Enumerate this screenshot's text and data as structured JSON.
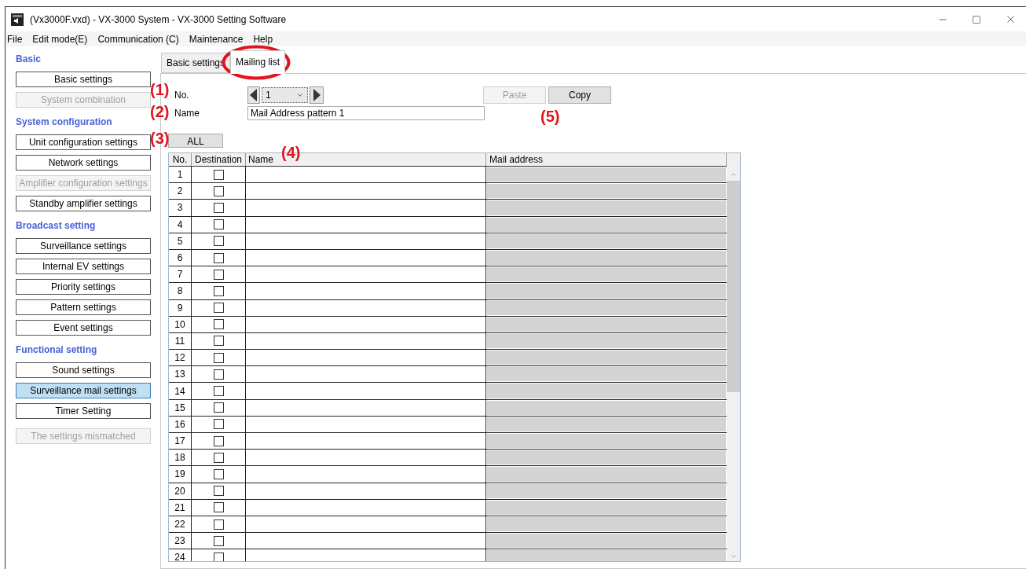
{
  "window": {
    "title": "(Vx3000F.vxd) - VX-3000 System - VX-3000 Setting Software"
  },
  "menu": [
    "File",
    "Edit mode(E)",
    "Communication (C)",
    "Maintenance",
    "Help"
  ],
  "sidebar": {
    "sections": [
      {
        "title": "Basic",
        "items": [
          {
            "label": "Basic settings",
            "selected": false,
            "disabled": false
          },
          {
            "label": "System combination",
            "selected": false,
            "disabled": true
          }
        ]
      },
      {
        "title": "System configuration",
        "items": [
          {
            "label": "Unit configuration settings",
            "selected": false,
            "disabled": false
          },
          {
            "label": "Network settings",
            "selected": false,
            "disabled": false
          },
          {
            "label": "Amplifier configuration settings",
            "selected": false,
            "disabled": true
          },
          {
            "label": "Standby amplifier settings",
            "selected": false,
            "disabled": false
          }
        ]
      },
      {
        "title": "Broadcast setting",
        "items": [
          {
            "label": "Surveillance settings",
            "selected": false,
            "disabled": false
          },
          {
            "label": "Internal EV settings",
            "selected": false,
            "disabled": false
          },
          {
            "label": "Priority settings",
            "selected": false,
            "disabled": false
          },
          {
            "label": "Pattern settings",
            "selected": false,
            "disabled": false
          },
          {
            "label": "Event settings",
            "selected": false,
            "disabled": false
          }
        ]
      },
      {
        "title": "Functional setting",
        "items": [
          {
            "label": "Sound settings",
            "selected": false,
            "disabled": false
          },
          {
            "label": "Surveillance mail settings",
            "selected": true,
            "disabled": false
          },
          {
            "label": "Timer Setting",
            "selected": false,
            "disabled": false
          }
        ]
      }
    ],
    "mismatch_button": {
      "label": "The settings mismatched",
      "disabled": true
    }
  },
  "tabs": [
    {
      "label": "Basic settings",
      "selected": false
    },
    {
      "label": "Mailing list",
      "selected": true
    }
  ],
  "form": {
    "no_label": "No.",
    "no_value": "1",
    "name_label": "Name",
    "name_value": "Mail Address pattern 1",
    "paste": {
      "label": "Paste",
      "disabled": true
    },
    "copy": {
      "label": "Copy",
      "disabled": false
    },
    "all_button": "ALL"
  },
  "table": {
    "columns": [
      "No.",
      "Destination",
      "Name",
      "Mail address"
    ],
    "rows": [
      {
        "no": "1",
        "checked": false
      },
      {
        "no": "2",
        "checked": false
      },
      {
        "no": "3",
        "checked": false
      },
      {
        "no": "4",
        "checked": false
      },
      {
        "no": "5",
        "checked": false
      },
      {
        "no": "6",
        "checked": false
      },
      {
        "no": "7",
        "checked": false
      },
      {
        "no": "8",
        "checked": false
      },
      {
        "no": "9",
        "checked": false
      },
      {
        "no": "10",
        "checked": false
      },
      {
        "no": "11",
        "checked": false
      },
      {
        "no": "12",
        "checked": false
      },
      {
        "no": "13",
        "checked": false
      },
      {
        "no": "14",
        "checked": false
      },
      {
        "no": "15",
        "checked": false
      },
      {
        "no": "16",
        "checked": false
      },
      {
        "no": "17",
        "checked": false
      },
      {
        "no": "18",
        "checked": false
      },
      {
        "no": "19",
        "checked": false
      },
      {
        "no": "20",
        "checked": false
      },
      {
        "no": "21",
        "checked": false
      },
      {
        "no": "22",
        "checked": false
      },
      {
        "no": "23",
        "checked": false
      },
      {
        "no": "24",
        "checked": false
      }
    ]
  },
  "annotations": [
    "(1)",
    "(2)",
    "(3)",
    "(4)",
    "(5)"
  ]
}
